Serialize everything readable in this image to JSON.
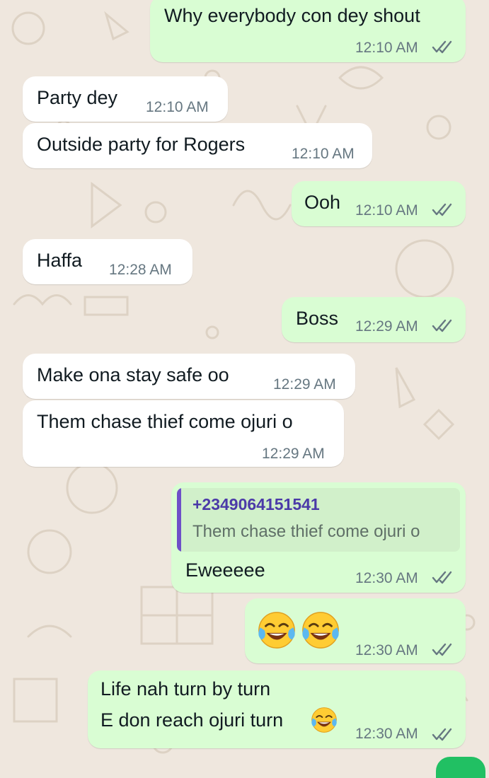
{
  "colors": {
    "wallpaper": "#efe7de",
    "incoming_bubble": "#ffffff",
    "outgoing_bubble": "#d9fdd3",
    "read_ticks": "#667781",
    "quote_accent": "#6e4fc8"
  },
  "messages": [
    {
      "dir": "out",
      "text": "Why everybody con dey shout",
      "time": "12:10 AM"
    },
    {
      "dir": "in",
      "text": "Party dey",
      "time": "12:10 AM"
    },
    {
      "dir": "in",
      "text": "Outside party for Rogers",
      "time": "12:10 AM"
    },
    {
      "dir": "out",
      "text": "Ooh",
      "time": "12:10 AM"
    },
    {
      "dir": "in",
      "text": "Haffa",
      "time": "12:28 AM"
    },
    {
      "dir": "out",
      "text": "Boss",
      "time": "12:29 AM"
    },
    {
      "dir": "in",
      "text": "Make ona stay safe oo",
      "time": "12:29 AM"
    },
    {
      "dir": "in",
      "text": "Them chase thief come ojuri o",
      "time": "12:29 AM"
    },
    {
      "dir": "out",
      "reply": {
        "sender": "+2349064151541",
        "text": "Them chase thief come ojuri o"
      },
      "text": "Eweeeee",
      "time": "12:30 AM"
    },
    {
      "dir": "out",
      "text": "",
      "emoji": "face-with-tears-of-joy x2",
      "time": "12:30 AM"
    },
    {
      "dir": "out",
      "text_line1": "Life nah turn by turn",
      "text_line2": "E don reach ojuri turn",
      "emoji": "face-with-tears-of-joy",
      "time": "12:30 AM"
    }
  ]
}
